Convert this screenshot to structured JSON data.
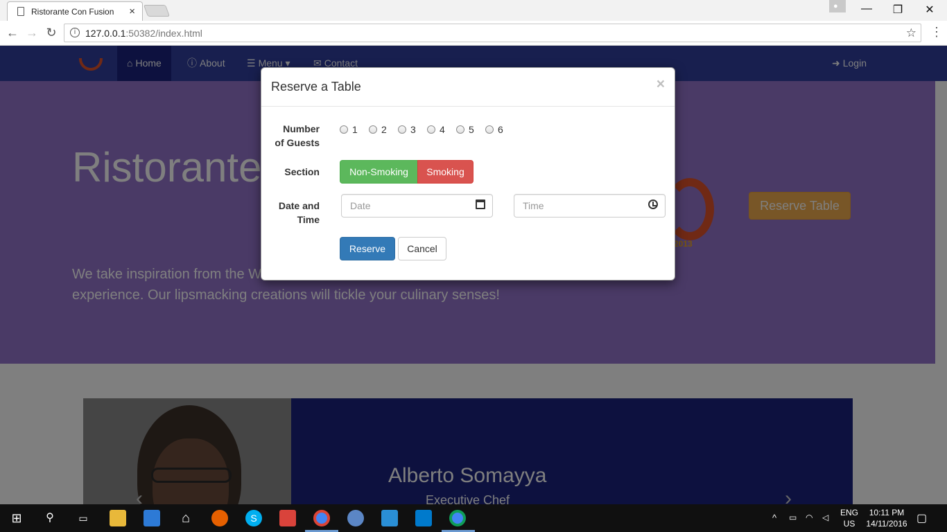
{
  "browser": {
    "tab_title": "Ristorante Con Fusion",
    "tab_close": "×",
    "url_host": "127.0.0.1",
    "url_rest": ":50382/index.html",
    "window_controls": {
      "minimize": "—",
      "maximize": "❐",
      "close": "✕"
    }
  },
  "navbar": {
    "items": [
      {
        "label": "Home",
        "icon": "home-icon"
      },
      {
        "label": "About",
        "icon": "info-icon"
      },
      {
        "label": "Menu",
        "icon": "list-icon"
      },
      {
        "label": "Contact",
        "icon": "envelope-icon"
      }
    ],
    "login": "Login"
  },
  "jumbotron": {
    "heading": "Ristorante",
    "text_line1": "We take inspiration from the W",
    "text_line2": "experience. Our lipsmacking creations will tickle your culinary senses!",
    "logo_year": "2013",
    "reserve_button": "Reserve Table"
  },
  "chef": {
    "name": "Alberto Somayya",
    "role": "Executive Chef"
  },
  "modal": {
    "title": "Reserve a Table",
    "close": "×",
    "guests_label_line1": "Number",
    "guests_label_line2": "of Guests",
    "guest_options": [
      "1",
      "2",
      "3",
      "4",
      "5",
      "6"
    ],
    "section_label": "Section",
    "section_options": {
      "non_smoking": "Non-Smoking",
      "smoking": "Smoking"
    },
    "datetime_label_line1": "Date and",
    "datetime_label_line2": "Time",
    "date_placeholder": "Date",
    "time_placeholder": "Time",
    "reserve_button": "Reserve",
    "cancel_button": "Cancel"
  },
  "taskbar": {
    "language_line1": "ENG",
    "language_line2": "US",
    "time": "10:11 PM",
    "date": "14/11/2016"
  },
  "colors": {
    "navbar": "#303f9f",
    "navbar_active": "#1a237e",
    "jumbotron": "#9575cd",
    "success": "#5cb85c",
    "danger": "#d9534f",
    "primary": "#337ab7",
    "warning": "#f0ad4e"
  }
}
